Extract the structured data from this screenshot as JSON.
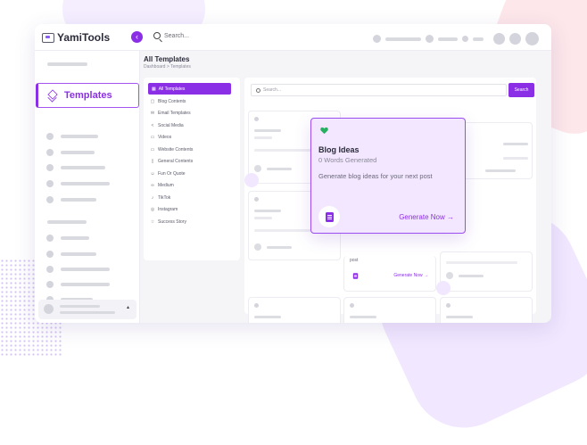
{
  "app": {
    "name": "YamiTools",
    "brand_color": "#8b2fe6"
  },
  "topbar": {
    "search_placeholder": "Search...",
    "collapse_icon": "chevron-left-icon"
  },
  "sidebar": {
    "active_item": "Templates",
    "active_icon": "layers-icon"
  },
  "page": {
    "title": "All Templates",
    "breadcrumb": "Dashboard  >  Templates"
  },
  "categories": [
    {
      "label": "All Templates",
      "icon": "grid-icon",
      "active": true
    },
    {
      "label": "Blog Contents",
      "icon": "book-icon"
    },
    {
      "label": "Email Templates",
      "icon": "mail-icon"
    },
    {
      "label": "Social Media",
      "icon": "share-icon"
    },
    {
      "label": "Videos",
      "icon": "video-icon"
    },
    {
      "label": "Website Contents",
      "icon": "monitor-icon"
    },
    {
      "label": "General Contents",
      "icon": "file-icon"
    },
    {
      "label": "Fun Or Quote",
      "icon": "smile-icon"
    },
    {
      "label": "Medium",
      "icon": "medium-icon"
    },
    {
      "label": "TikTok",
      "icon": "tiktok-icon"
    },
    {
      "label": "Instagram",
      "icon": "instagram-icon"
    },
    {
      "label": "Success Story",
      "icon": "star-icon"
    }
  ],
  "content": {
    "search_placeholder": "Search...",
    "search_button": "Search",
    "visible_card_fragment": "post",
    "visible_card_cta": "Generate Now →",
    "row3_count": "1"
  },
  "popup": {
    "title": "Blog Ideas",
    "subtitle": "0 Words Generated",
    "description": "Generate blog ideas for your next post",
    "cta": "Generate Now →",
    "heart_color": "#27ae60"
  }
}
